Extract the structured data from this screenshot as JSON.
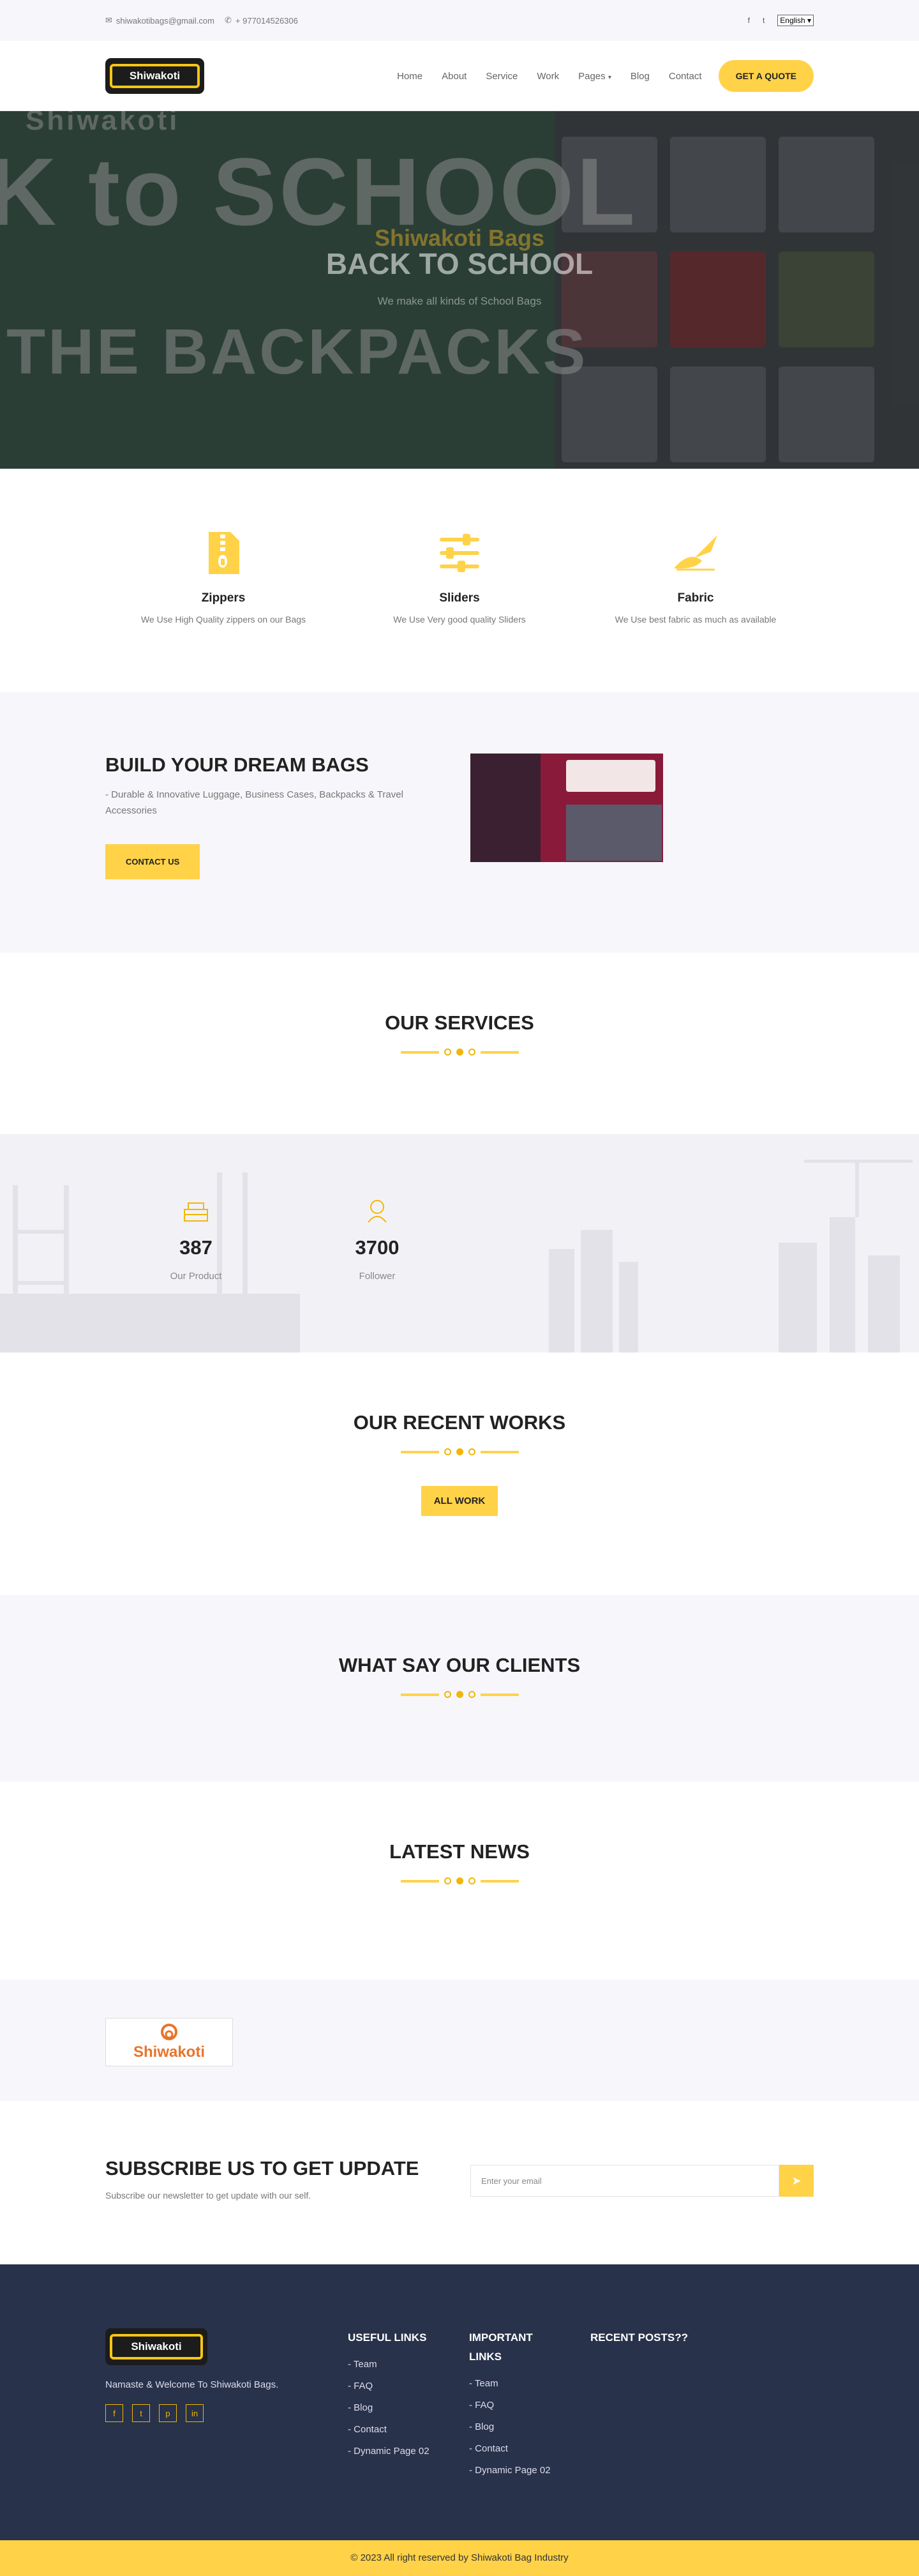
{
  "topbar": {
    "email": "shiwakotibags@gmail.com",
    "phone": "+ 977014526306",
    "language": "English"
  },
  "nav": {
    "logo_text": "Shiwakoti",
    "items": [
      "Home",
      "About",
      "Service",
      "Work",
      "Pages",
      "Blog",
      "Contact"
    ],
    "quote_label": "GET A QUOTE"
  },
  "hero": {
    "subtitle": "Shiwakoti Bags",
    "title": "BACK TO SCHOOL",
    "text": "We make all kinds of School Bags",
    "image_text_1": "K to SCHOOL",
    "image_text_2": "THE BACKPACKS",
    "image_watermark": "Shiwakoti"
  },
  "features": [
    {
      "icon": "zipper-icon",
      "title": "Zippers",
      "text": "We Use High Quality zippers on our Bags"
    },
    {
      "icon": "sliders-icon",
      "title": "Sliders",
      "text": "We Use Very good quality Sliders"
    },
    {
      "icon": "fabric-icon",
      "title": "Fabric",
      "text": "We Use best fabric as much as available"
    }
  ],
  "dream": {
    "title": "BUILD YOUR DREAM BAGS",
    "desc": "- Durable & Innovative Luggage, Business Cases, Backpacks & Travel Accessories",
    "button": "CONTACT US"
  },
  "services": {
    "title": "OUR SERVICES"
  },
  "counters": [
    {
      "icon": "product-icon",
      "value": "387",
      "label": "Our Product"
    },
    {
      "icon": "follower-icon",
      "value": "3700",
      "label": "Follower"
    }
  ],
  "recent": {
    "title": "OUR RECENT WORKS",
    "button": "ALL WORK"
  },
  "clients": {
    "title": "WHAT SAY OUR CLIENTS"
  },
  "news": {
    "title": "LATEST NEWS"
  },
  "partner": {
    "name": "Shiwakoti"
  },
  "subscribe": {
    "title": "SUBSCRIBE US TO GET UPDATE",
    "text": "Subscribe our newsletter to get update with our self.",
    "placeholder": "Enter your email"
  },
  "footer": {
    "tagline": "Namaste & Welcome To Shiwakoti Bags.",
    "useful_title": "USEFUL LINKS",
    "useful_links": [
      "- Team",
      "- FAQ",
      "- Blog",
      "- Contact",
      "- Dynamic Page 02"
    ],
    "important_title": "IMPORTANT LINKS",
    "important_links": [
      "- Team",
      "- FAQ",
      "- Blog",
      "- Contact",
      "- Dynamic Page 02"
    ],
    "recent_title": "RECENT POSTS??",
    "copyright": "© 2023 All right reserved by Shiwakoti Bag Industry"
  },
  "colors": {
    "accent": "#ffd248",
    "footer_bg": "#28324a",
    "light_bg": "#f7f7fb"
  }
}
